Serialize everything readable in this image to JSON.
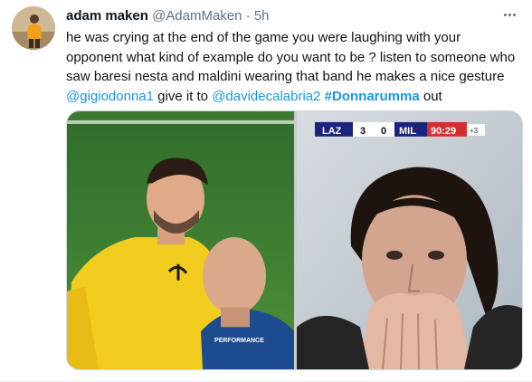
{
  "tweet": {
    "author_name": "adam maken",
    "author_handle": "@AdamMaken",
    "separator": "·",
    "time": "5h",
    "text_1": "he was crying at the end of the game you were laughing with your opponent what kind of example do you want to be ? listen to someone who saw baresi nesta and maldini wearing that band he makes a nice gesture ",
    "mention_1": "@gigiodonna1",
    "text_2": " give it to ",
    "mention_2": "@davidecalabria2",
    "text_3": " ",
    "hashtag": "#Donnarumma",
    "text_4": " out"
  },
  "scoreboard": {
    "home_team": "LAZ",
    "home_score": "3",
    "away_score": "0",
    "away_team": "MIL",
    "clock": "90:29",
    "added_time": "+3"
  },
  "shirt": {
    "sponsor": "PERFORMANCE"
  },
  "icons": {
    "avatar": "avatar-icon",
    "more": "more-horizontal-icon"
  },
  "colors": {
    "link": "#1b95e0",
    "secondary_text": "#5b7083",
    "primary_text": "#0f1419",
    "score_clock_bg": "#d32f2f",
    "score_team_bg": "#1a237e"
  }
}
